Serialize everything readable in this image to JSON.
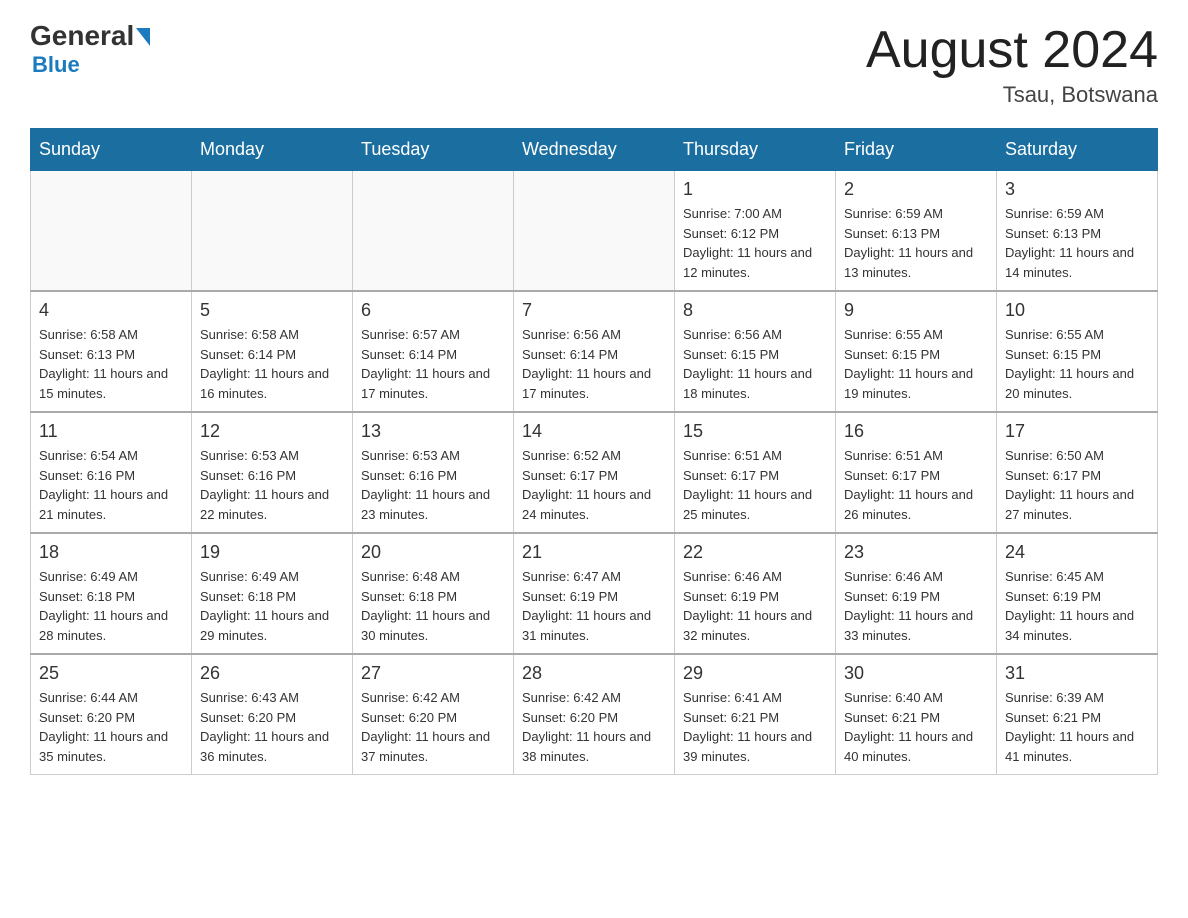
{
  "header": {
    "logo_general": "General",
    "logo_blue": "Blue",
    "month_title": "August 2024",
    "location": "Tsau, Botswana"
  },
  "days_of_week": [
    "Sunday",
    "Monday",
    "Tuesday",
    "Wednesday",
    "Thursday",
    "Friday",
    "Saturday"
  ],
  "weeks": [
    [
      {
        "date": "",
        "info": ""
      },
      {
        "date": "",
        "info": ""
      },
      {
        "date": "",
        "info": ""
      },
      {
        "date": "",
        "info": ""
      },
      {
        "date": "1",
        "info": "Sunrise: 7:00 AM\nSunset: 6:12 PM\nDaylight: 11 hours and 12 minutes."
      },
      {
        "date": "2",
        "info": "Sunrise: 6:59 AM\nSunset: 6:13 PM\nDaylight: 11 hours and 13 minutes."
      },
      {
        "date": "3",
        "info": "Sunrise: 6:59 AM\nSunset: 6:13 PM\nDaylight: 11 hours and 14 minutes."
      }
    ],
    [
      {
        "date": "4",
        "info": "Sunrise: 6:58 AM\nSunset: 6:13 PM\nDaylight: 11 hours and 15 minutes."
      },
      {
        "date": "5",
        "info": "Sunrise: 6:58 AM\nSunset: 6:14 PM\nDaylight: 11 hours and 16 minutes."
      },
      {
        "date": "6",
        "info": "Sunrise: 6:57 AM\nSunset: 6:14 PM\nDaylight: 11 hours and 17 minutes."
      },
      {
        "date": "7",
        "info": "Sunrise: 6:56 AM\nSunset: 6:14 PM\nDaylight: 11 hours and 17 minutes."
      },
      {
        "date": "8",
        "info": "Sunrise: 6:56 AM\nSunset: 6:15 PM\nDaylight: 11 hours and 18 minutes."
      },
      {
        "date": "9",
        "info": "Sunrise: 6:55 AM\nSunset: 6:15 PM\nDaylight: 11 hours and 19 minutes."
      },
      {
        "date": "10",
        "info": "Sunrise: 6:55 AM\nSunset: 6:15 PM\nDaylight: 11 hours and 20 minutes."
      }
    ],
    [
      {
        "date": "11",
        "info": "Sunrise: 6:54 AM\nSunset: 6:16 PM\nDaylight: 11 hours and 21 minutes."
      },
      {
        "date": "12",
        "info": "Sunrise: 6:53 AM\nSunset: 6:16 PM\nDaylight: 11 hours and 22 minutes."
      },
      {
        "date": "13",
        "info": "Sunrise: 6:53 AM\nSunset: 6:16 PM\nDaylight: 11 hours and 23 minutes."
      },
      {
        "date": "14",
        "info": "Sunrise: 6:52 AM\nSunset: 6:17 PM\nDaylight: 11 hours and 24 minutes."
      },
      {
        "date": "15",
        "info": "Sunrise: 6:51 AM\nSunset: 6:17 PM\nDaylight: 11 hours and 25 minutes."
      },
      {
        "date": "16",
        "info": "Sunrise: 6:51 AM\nSunset: 6:17 PM\nDaylight: 11 hours and 26 minutes."
      },
      {
        "date": "17",
        "info": "Sunrise: 6:50 AM\nSunset: 6:17 PM\nDaylight: 11 hours and 27 minutes."
      }
    ],
    [
      {
        "date": "18",
        "info": "Sunrise: 6:49 AM\nSunset: 6:18 PM\nDaylight: 11 hours and 28 minutes."
      },
      {
        "date": "19",
        "info": "Sunrise: 6:49 AM\nSunset: 6:18 PM\nDaylight: 11 hours and 29 minutes."
      },
      {
        "date": "20",
        "info": "Sunrise: 6:48 AM\nSunset: 6:18 PM\nDaylight: 11 hours and 30 minutes."
      },
      {
        "date": "21",
        "info": "Sunrise: 6:47 AM\nSunset: 6:19 PM\nDaylight: 11 hours and 31 minutes."
      },
      {
        "date": "22",
        "info": "Sunrise: 6:46 AM\nSunset: 6:19 PM\nDaylight: 11 hours and 32 minutes."
      },
      {
        "date": "23",
        "info": "Sunrise: 6:46 AM\nSunset: 6:19 PM\nDaylight: 11 hours and 33 minutes."
      },
      {
        "date": "24",
        "info": "Sunrise: 6:45 AM\nSunset: 6:19 PM\nDaylight: 11 hours and 34 minutes."
      }
    ],
    [
      {
        "date": "25",
        "info": "Sunrise: 6:44 AM\nSunset: 6:20 PM\nDaylight: 11 hours and 35 minutes."
      },
      {
        "date": "26",
        "info": "Sunrise: 6:43 AM\nSunset: 6:20 PM\nDaylight: 11 hours and 36 minutes."
      },
      {
        "date": "27",
        "info": "Sunrise: 6:42 AM\nSunset: 6:20 PM\nDaylight: 11 hours and 37 minutes."
      },
      {
        "date": "28",
        "info": "Sunrise: 6:42 AM\nSunset: 6:20 PM\nDaylight: 11 hours and 38 minutes."
      },
      {
        "date": "29",
        "info": "Sunrise: 6:41 AM\nSunset: 6:21 PM\nDaylight: 11 hours and 39 minutes."
      },
      {
        "date": "30",
        "info": "Sunrise: 6:40 AM\nSunset: 6:21 PM\nDaylight: 11 hours and 40 minutes."
      },
      {
        "date": "31",
        "info": "Sunrise: 6:39 AM\nSunset: 6:21 PM\nDaylight: 11 hours and 41 minutes."
      }
    ]
  ]
}
